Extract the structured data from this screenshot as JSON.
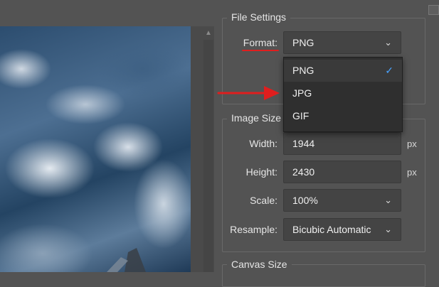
{
  "file_settings": {
    "title": "File Settings",
    "format_label": "Format:",
    "format_value": "PNG",
    "format_options": [
      {
        "label": "PNG",
        "selected": true
      },
      {
        "label": "JPG",
        "selected": false
      },
      {
        "label": "GIF",
        "selected": false
      }
    ]
  },
  "image_size": {
    "title": "Image Size",
    "width_label": "Width:",
    "width_value": "1944",
    "width_unit": "px",
    "height_label": "Height:",
    "height_value": "2430",
    "height_unit": "px",
    "scale_label": "Scale:",
    "scale_value": "100%",
    "resample_label": "Resample:",
    "resample_value": "Bicubic Automatic"
  },
  "canvas_size": {
    "title": "Canvas Size"
  },
  "icons": {
    "dropdown": "chevron-down-icon",
    "selected": "checkmark-icon",
    "scroll_up": "scroll-up-arrow-icon",
    "annotation": "red-arrow-icon"
  },
  "colors": {
    "annotation_red": "#e01e1e",
    "check_blue": "#4aa3ff",
    "panel_bg": "#535353",
    "field_bg": "#444444",
    "dropdown_bg": "#2f2f2f"
  }
}
